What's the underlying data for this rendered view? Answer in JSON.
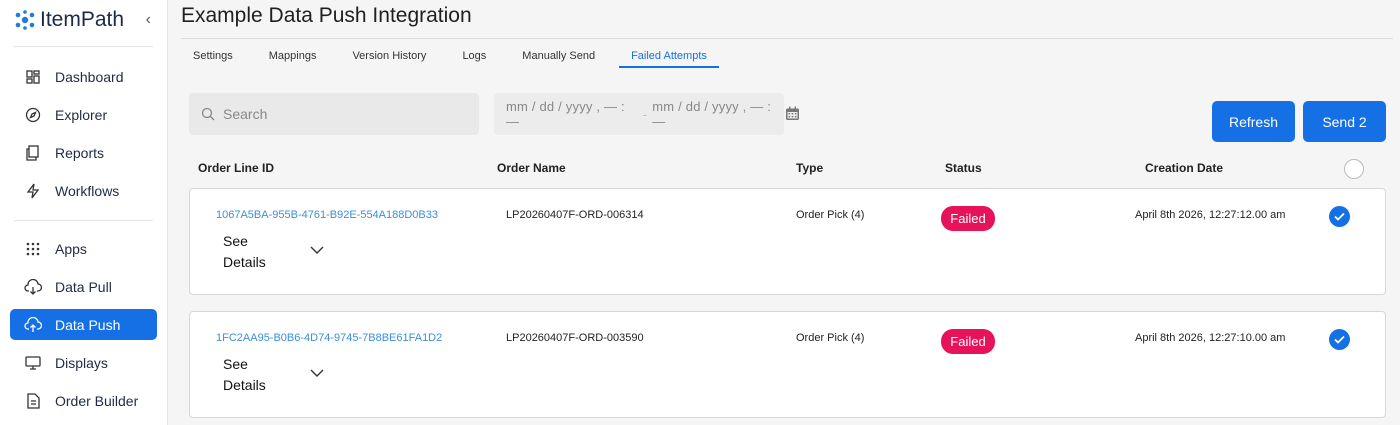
{
  "sidebar": {
    "brand": "ItemPath",
    "items_top": [
      {
        "label": "Dashboard",
        "icon": "dashboard-icon"
      },
      {
        "label": "Explorer",
        "icon": "compass-icon"
      },
      {
        "label": "Reports",
        "icon": "reports-icon"
      },
      {
        "label": "Workflows",
        "icon": "lightning-icon"
      }
    ],
    "items_bottom": [
      {
        "label": "Apps",
        "icon": "grid-icon"
      },
      {
        "label": "Data Pull",
        "icon": "cloud-download-icon"
      },
      {
        "label": "Data Push",
        "icon": "cloud-upload-icon",
        "active": true
      },
      {
        "label": "Displays",
        "icon": "monitor-icon"
      },
      {
        "label": "Order Builder",
        "icon": "document-icon"
      }
    ]
  },
  "page": {
    "title": "Example Data Push Integration",
    "tabs": [
      "Settings",
      "Mappings",
      "Version History",
      "Logs",
      "Manually Send",
      "Failed Attempts"
    ],
    "active_tab": "Failed Attempts"
  },
  "filters": {
    "search_placeholder": "Search",
    "date_start": "mm / dd / yyyy , — : —",
    "date_sep": "-",
    "date_end": "mm / dd / yyyy , — : —"
  },
  "actions": {
    "refresh": "Refresh",
    "send": "Send 2"
  },
  "table": {
    "headers": [
      "Order Line ID",
      "Order Name",
      "Type",
      "Status",
      "Creation Date"
    ],
    "rows": [
      {
        "id": "1067A5BA-955B-4761-B92E-554A188D0B33",
        "details_line1": "See",
        "details_line2": "Details",
        "order_name": "LP20260407F-ORD-006314",
        "type": "Order Pick (4)",
        "status": "Failed",
        "created": "April 8th 2026, 12:27:12.00 am",
        "checked": true
      },
      {
        "id": "1FC2AA95-B0B6-4D74-9745-7B8BE61FA1D2",
        "details_line1": "See",
        "details_line2": "Details",
        "order_name": "LP20260407F-ORD-003590",
        "type": "Order Pick (4)",
        "status": "Failed",
        "created": "April 8th 2026, 12:27:10.00 am",
        "checked": true
      }
    ]
  },
  "colors": {
    "accent": "#1570e6",
    "failed": "#e6125a",
    "link": "#3b8fd9"
  }
}
